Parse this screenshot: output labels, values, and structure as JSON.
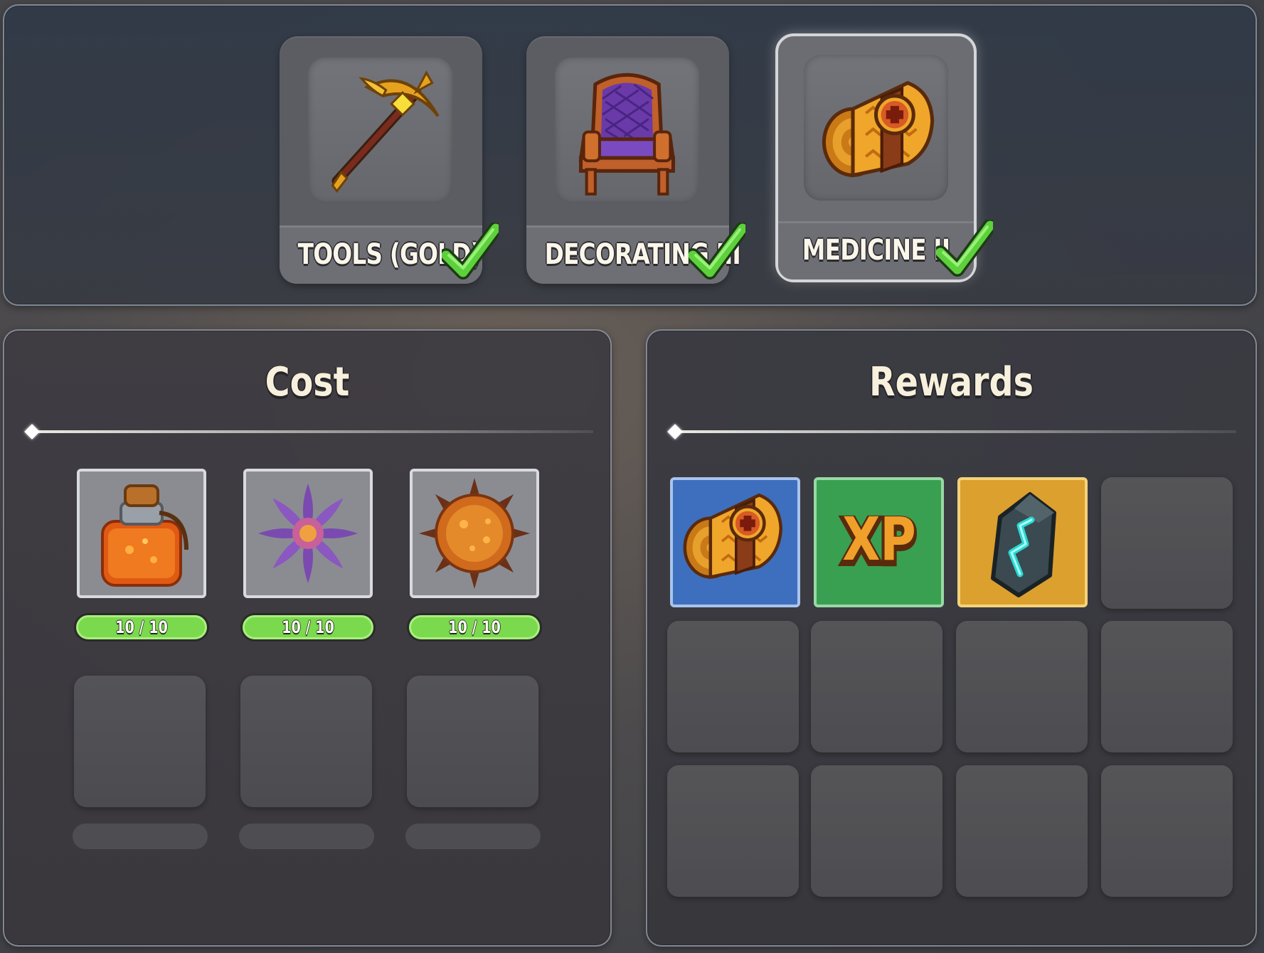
{
  "skills": [
    {
      "label": "TOOLS (GOLD)",
      "icon": "golden-pickaxe-icon",
      "completed": true,
      "selected": false
    },
    {
      "label": "DECORATING III",
      "icon": "purple-armchair-icon",
      "completed": true,
      "selected": false
    },
    {
      "label": "MEDICINE II",
      "icon": "medical-bandage-roll-icon",
      "completed": true,
      "selected": true
    }
  ],
  "cost": {
    "title": "Cost",
    "items": [
      {
        "icon": "orange-potion-jar-icon",
        "progress": "10 / 10",
        "have": 10,
        "need": 10
      },
      {
        "icon": "purple-flower-icon",
        "progress": "10 / 10",
        "have": 10,
        "need": 10
      },
      {
        "icon": "spiky-orange-seed-icon",
        "progress": "10 / 10",
        "have": 10,
        "need": 10
      }
    ]
  },
  "rewards": {
    "title": "Rewards",
    "items": [
      {
        "icon": "medical-bandage-roll-icon",
        "tile_color": "#3d6fbe"
      },
      {
        "icon": "xp-icon",
        "text": "XP",
        "tile_color": "#3aa051"
      },
      {
        "icon": "rune-stone-icon",
        "tile_color": "#dca02e"
      }
    ]
  },
  "colors": {
    "check": "#5cd13b",
    "progress_fill": "#7bd94e",
    "title_text": "#f7f0dc"
  }
}
